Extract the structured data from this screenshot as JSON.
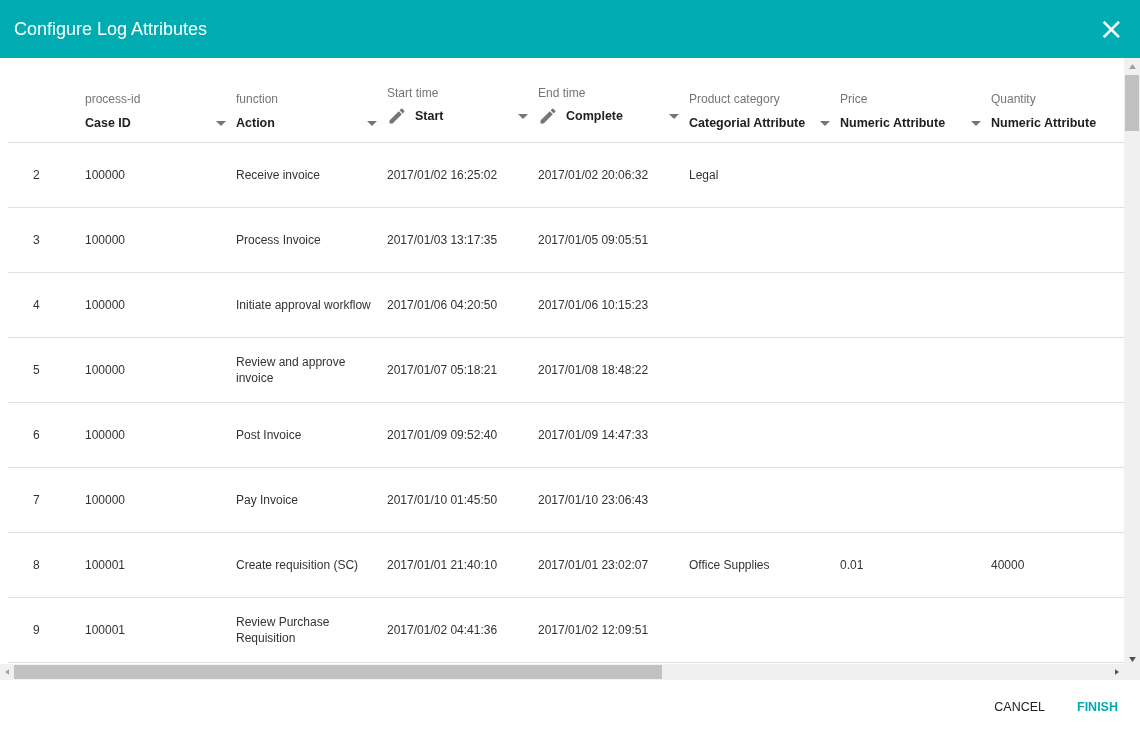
{
  "dialog": {
    "title": "Configure Log Attributes",
    "close": "×"
  },
  "columns": [
    {
      "attribute": "process-id",
      "type": "Case ID",
      "editable": false,
      "dropdown": true
    },
    {
      "attribute": "function",
      "type": "Action",
      "editable": false,
      "dropdown": true
    },
    {
      "attribute": "Start time",
      "type": "Start",
      "editable": true,
      "dropdown": true
    },
    {
      "attribute": "End time",
      "type": "Complete",
      "editable": true,
      "dropdown": true
    },
    {
      "attribute": "Product category",
      "type": "Categorial Attribute",
      "editable": false,
      "dropdown": true
    },
    {
      "attribute": "Price",
      "type": "Numeric Attribute",
      "editable": false,
      "dropdown": true
    },
    {
      "attribute": "Quantity",
      "type": "Numeric Attribute",
      "editable": false,
      "dropdown": false
    }
  ],
  "rows": [
    {
      "number": "2",
      "cells": [
        "100000",
        "Receive invoice",
        "2017/01/02 16:25:02",
        "2017/01/02 20:06:32",
        "Legal",
        null,
        null
      ]
    },
    {
      "number": "3",
      "cells": [
        "100000",
        "Process Invoice",
        "2017/01/03 13:17:35",
        "2017/01/05 09:05:51",
        null,
        null,
        null
      ]
    },
    {
      "number": "4",
      "cells": [
        "100000",
        "Initiate approval workflow",
        "2017/01/06 04:20:50",
        "2017/01/06 10:15:23",
        null,
        null,
        null
      ]
    },
    {
      "number": "5",
      "cells": [
        "100000",
        "Review and approve invoice",
        "2017/01/07 05:18:21",
        "2017/01/08 18:48:22",
        null,
        null,
        null
      ]
    },
    {
      "number": "6",
      "cells": [
        "100000",
        "Post Invoice",
        "2017/01/09 09:52:40",
        "2017/01/09 14:47:33",
        null,
        null,
        null
      ]
    },
    {
      "number": "7",
      "cells": [
        "100000",
        "Pay Invoice",
        "2017/01/10 01:45:50",
        "2017/01/10 23:06:43",
        null,
        null,
        null
      ]
    },
    {
      "number": "8",
      "cells": [
        "100001",
        "Create requisition (SC)",
        "2017/01/01 21:40:10",
        "2017/01/01 23:02:07",
        "Office Supplies",
        "0.01",
        "40000"
      ]
    },
    {
      "number": "9",
      "cells": [
        "100001",
        "Review Purchase Requisition",
        "2017/01/02 04:41:36",
        "2017/01/02 12:09:51",
        null,
        null,
        null
      ]
    }
  ],
  "buttons": [
    {
      "label": "CANCEL",
      "primary": false
    },
    {
      "label": "FINISH",
      "primary": true
    }
  ]
}
